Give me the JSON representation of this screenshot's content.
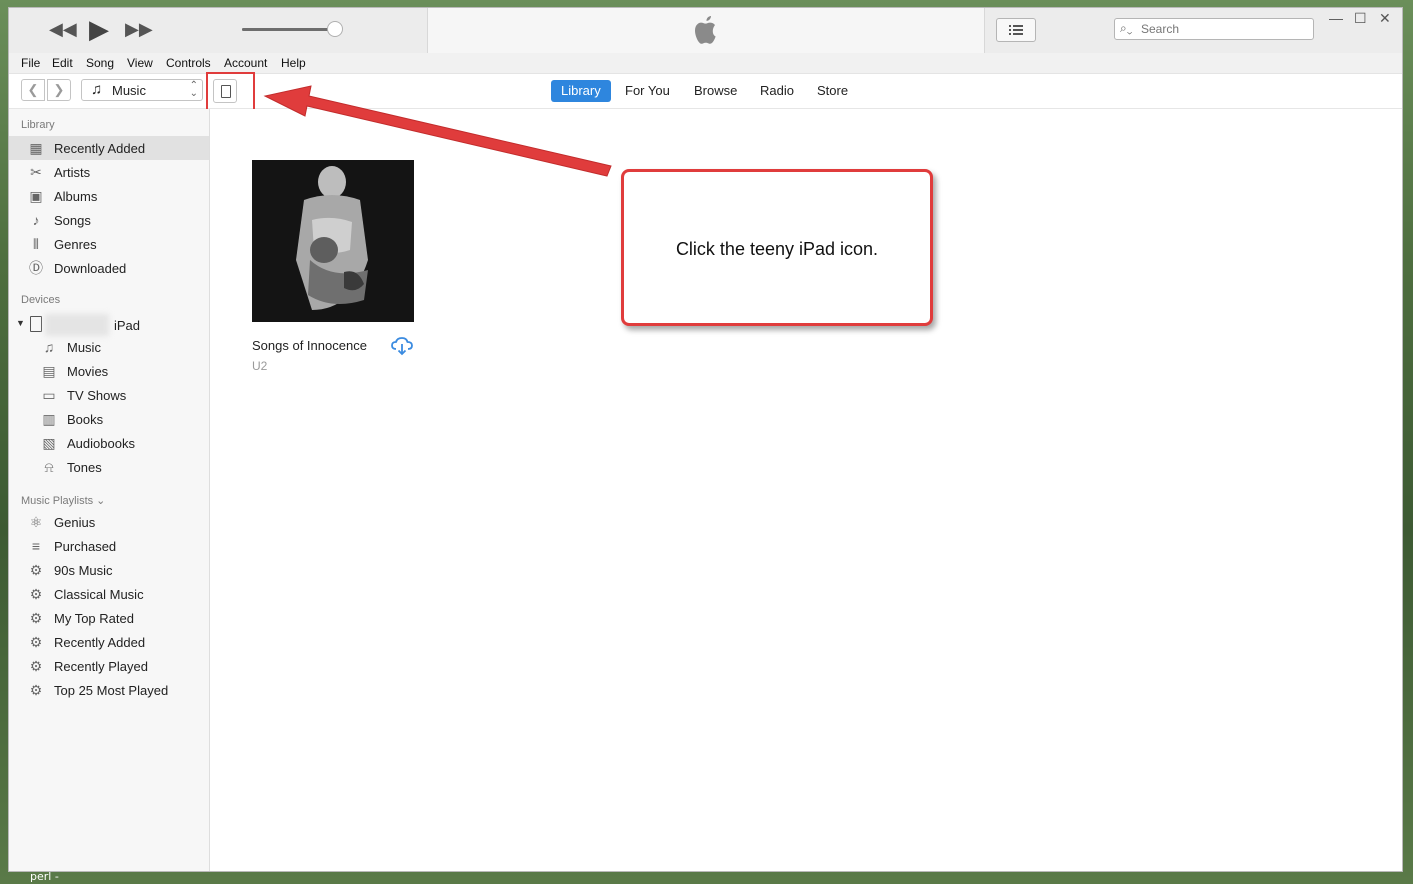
{
  "background": {
    "edge_text": "perl -"
  },
  "player": {
    "volume_fraction": 0.98
  },
  "search": {
    "placeholder": "Search"
  },
  "menubar": [
    "File",
    "Edit",
    "Song",
    "View",
    "Controls",
    "Account",
    "Help"
  ],
  "media_picker": {
    "selected": "Music"
  },
  "tabs": [
    {
      "label": "Library",
      "active": true
    },
    {
      "label": "For You",
      "active": false
    },
    {
      "label": "Browse",
      "active": false
    },
    {
      "label": "Radio",
      "active": false
    },
    {
      "label": "Store",
      "active": false
    }
  ],
  "sidebar": {
    "library_header": "Library",
    "library": [
      {
        "label": "Recently Added",
        "icon": "grid-icon",
        "selected": true
      },
      {
        "label": "Artists",
        "icon": "microphone-icon"
      },
      {
        "label": "Albums",
        "icon": "album-icon"
      },
      {
        "label": "Songs",
        "icon": "note-icon"
      },
      {
        "label": "Genres",
        "icon": "genres-icon"
      },
      {
        "label": "Downloaded",
        "icon": "download-circle-icon"
      }
    ],
    "devices_header": "Devices",
    "device_name": "iPad",
    "device_items": [
      {
        "label": "Music",
        "icon": "note-icon"
      },
      {
        "label": "Movies",
        "icon": "film-icon"
      },
      {
        "label": "TV Shows",
        "icon": "tv-icon"
      },
      {
        "label": "Books",
        "icon": "book-icon"
      },
      {
        "label": "Audiobooks",
        "icon": "audiobook-icon"
      },
      {
        "label": "Tones",
        "icon": "bell-icon"
      }
    ],
    "playlists_header": "Music Playlists ⌄",
    "playlists": [
      {
        "label": "Genius",
        "icon": "genius-icon"
      },
      {
        "label": "Purchased",
        "icon": "purchased-icon"
      },
      {
        "label": "90s Music",
        "icon": "gear-icon"
      },
      {
        "label": "Classical Music",
        "icon": "gear-icon"
      },
      {
        "label": "My Top Rated",
        "icon": "gear-icon"
      },
      {
        "label": "Recently Added",
        "icon": "gear-icon"
      },
      {
        "label": "Recently Played",
        "icon": "gear-icon"
      },
      {
        "label": "Top 25 Most Played",
        "icon": "gear-icon"
      }
    ]
  },
  "album": {
    "title": "Songs of Innocence",
    "artist": "U2"
  },
  "callout": {
    "text": "Click the teeny iPad icon."
  },
  "colors": {
    "accent": "#2e86de",
    "annotation": "#e03c3c"
  }
}
